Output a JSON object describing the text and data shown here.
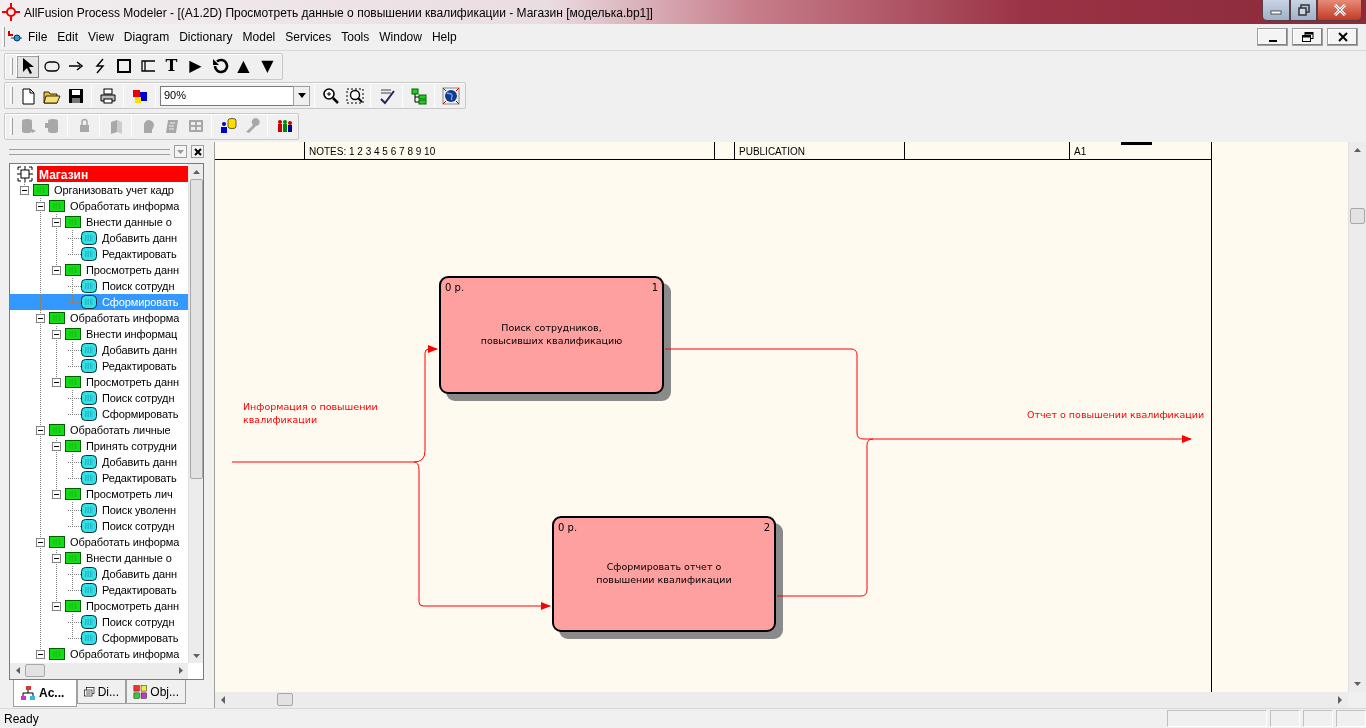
{
  "window": {
    "title": "AllFusion Process Modeler - [(A1.2D) Просмотреть данные о повышении квалификации - Магазин  [моделька.bp1]]"
  },
  "menu": [
    {
      "label": "File"
    },
    {
      "label": "Edit"
    },
    {
      "label": "View"
    },
    {
      "label": "Diagram"
    },
    {
      "label": "Dictionary"
    },
    {
      "label": "Model"
    },
    {
      "label": "Services"
    },
    {
      "label": "Tools"
    },
    {
      "label": "Window"
    },
    {
      "label": "Help"
    }
  ],
  "tool_palette": [
    {
      "kind": "pointer",
      "selected": true
    },
    {
      "kind": "ellipse",
      "selected": false
    },
    {
      "kind": "arrow",
      "selected": false
    },
    {
      "kind": "squiggle",
      "selected": false
    },
    {
      "kind": "box",
      "selected": false
    },
    {
      "kind": "bracket",
      "selected": false
    },
    {
      "kind": "glyph",
      "glyph": "T",
      "selected": false
    },
    {
      "kind": "glyph",
      "glyph": "▶",
      "selected": false
    },
    {
      "kind": "rotate",
      "selected": false
    },
    {
      "kind": "glyph",
      "glyph": "▲",
      "selected": false
    },
    {
      "kind": "glyph",
      "glyph": "▼",
      "selected": false
    }
  ],
  "zoom_combo": {
    "value": "90%"
  },
  "model_tree": {
    "root": "Магазин",
    "items": [
      {
        "label": "Организовать учет кадр",
        "selected": false,
        "expanded": true,
        "children": [
          {
            "label": "Обработать информа",
            "selected": false,
            "expanded": true,
            "children": [
              {
                "label": "Внести данные о",
                "selected": false,
                "expanded": true,
                "children": [
                  {
                    "label": "Добавить данн",
                    "selected": false
                  },
                  {
                    "label": "Редактировать",
                    "selected": false
                  }
                ]
              },
              {
                "label": "Просмотреть данн",
                "selected": false,
                "expanded": true,
                "children": [
                  {
                    "label": "Поиск сотрудн",
                    "selected": false
                  },
                  {
                    "label": "Сформировать",
                    "selected": true
                  }
                ]
              }
            ]
          },
          {
            "label": "Обработать информа",
            "selected": false,
            "expanded": true,
            "children": [
              {
                "label": "Внести информац",
                "selected": false,
                "expanded": true,
                "children": [
                  {
                    "label": "Добавить данн",
                    "selected": false
                  },
                  {
                    "label": "Редактировать",
                    "selected": false
                  }
                ]
              },
              {
                "label": "Просмотреть данн",
                "selected": false,
                "expanded": true,
                "children": [
                  {
                    "label": "Поиск сотрудн",
                    "selected": false
                  },
                  {
                    "label": "Сформировать",
                    "selected": false
                  }
                ]
              }
            ]
          },
          {
            "label": "Обработать  личные",
            "selected": false,
            "expanded": true,
            "children": [
              {
                "label": "Принять сотрудни",
                "selected": false,
                "expanded": true,
                "children": [
                  {
                    "label": "Добавить данн",
                    "selected": false
                  },
                  {
                    "label": "Редактировать",
                    "selected": false
                  }
                ]
              },
              {
                "label": "Просмотреть  лич",
                "selected": false,
                "expanded": true,
                "children": [
                  {
                    "label": "Поиск уволенн",
                    "selected": false
                  },
                  {
                    "label": "Поиск сотрудн",
                    "selected": false
                  }
                ]
              }
            ]
          },
          {
            "label": "Обработать информа",
            "selected": false,
            "expanded": true,
            "children": [
              {
                "label": "Внести данные  о",
                "selected": false,
                "expanded": true,
                "children": [
                  {
                    "label": "Добавить данн",
                    "selected": false
                  },
                  {
                    "label": "Редактировать",
                    "selected": false
                  }
                ]
              },
              {
                "label": "Просмотреть данн",
                "selected": false,
                "expanded": true,
                "children": [
                  {
                    "label": "Поиск сотрудн",
                    "selected": false
                  },
                  {
                    "label": "Сформировать",
                    "selected": false
                  }
                ]
              }
            ]
          },
          {
            "label": "Обработать информа",
            "selected": false,
            "expanded": true
          }
        ]
      }
    ]
  },
  "explorer_tabs": [
    {
      "kind": "activities",
      "label": "Ac...",
      "selected": true
    },
    {
      "kind": "diagrams",
      "label": "Di...",
      "selected": false
    },
    {
      "kind": "objects",
      "label": "Obj...",
      "selected": false
    }
  ],
  "diagram_frame": {
    "notes": "NOTES:  1  2  3  4  5  6  7  8  9  10",
    "publication": "PUBLICATION",
    "node": "A1"
  },
  "activities": [
    {
      "cost": "0 р.",
      "number": "1",
      "text": "Поиск сотрудников,\nповысивших квалификацию"
    },
    {
      "cost": "0 р.",
      "number": "2",
      "text": "Сформировать отчет о\nповышении квалификации"
    }
  ],
  "arrow_labels": [
    {
      "text": "Информация о повышении\nквалификации"
    },
    {
      "text": "Отчет о повышении квалификации"
    }
  ],
  "status_bar": {
    "text": "Ready"
  }
}
